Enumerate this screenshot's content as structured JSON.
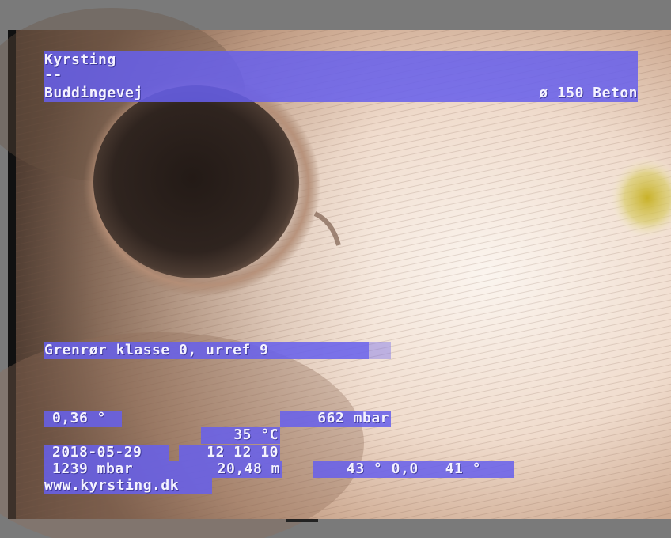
{
  "overlay": {
    "header": {
      "line1": "Kyrsting",
      "line2": "--",
      "line3_left": "Buddingevej",
      "line3_right": "ø 150 Beton"
    },
    "classification": "Grenrør klasse 0, urref 9",
    "readings": {
      "angle": "0,36 °",
      "pressure_top": "662 mbar",
      "temperature": "35 °C",
      "date": "2018-05-29",
      "time": "12 12 10",
      "pressure_bottom": "1239 mbar",
      "distance": "20,48 m",
      "orientation": "43 ° 0,0   41 °",
      "website": "www.kyrsting.dk"
    },
    "colors": {
      "overlay_bar": "#6660ec",
      "overlay_text": "#f4f2ff",
      "frame_border": "#7a7a7a",
      "pipe_wall": "#f1ddd0",
      "pipe_opening": "#2d221d",
      "debris_spot": "#c9b229"
    }
  }
}
